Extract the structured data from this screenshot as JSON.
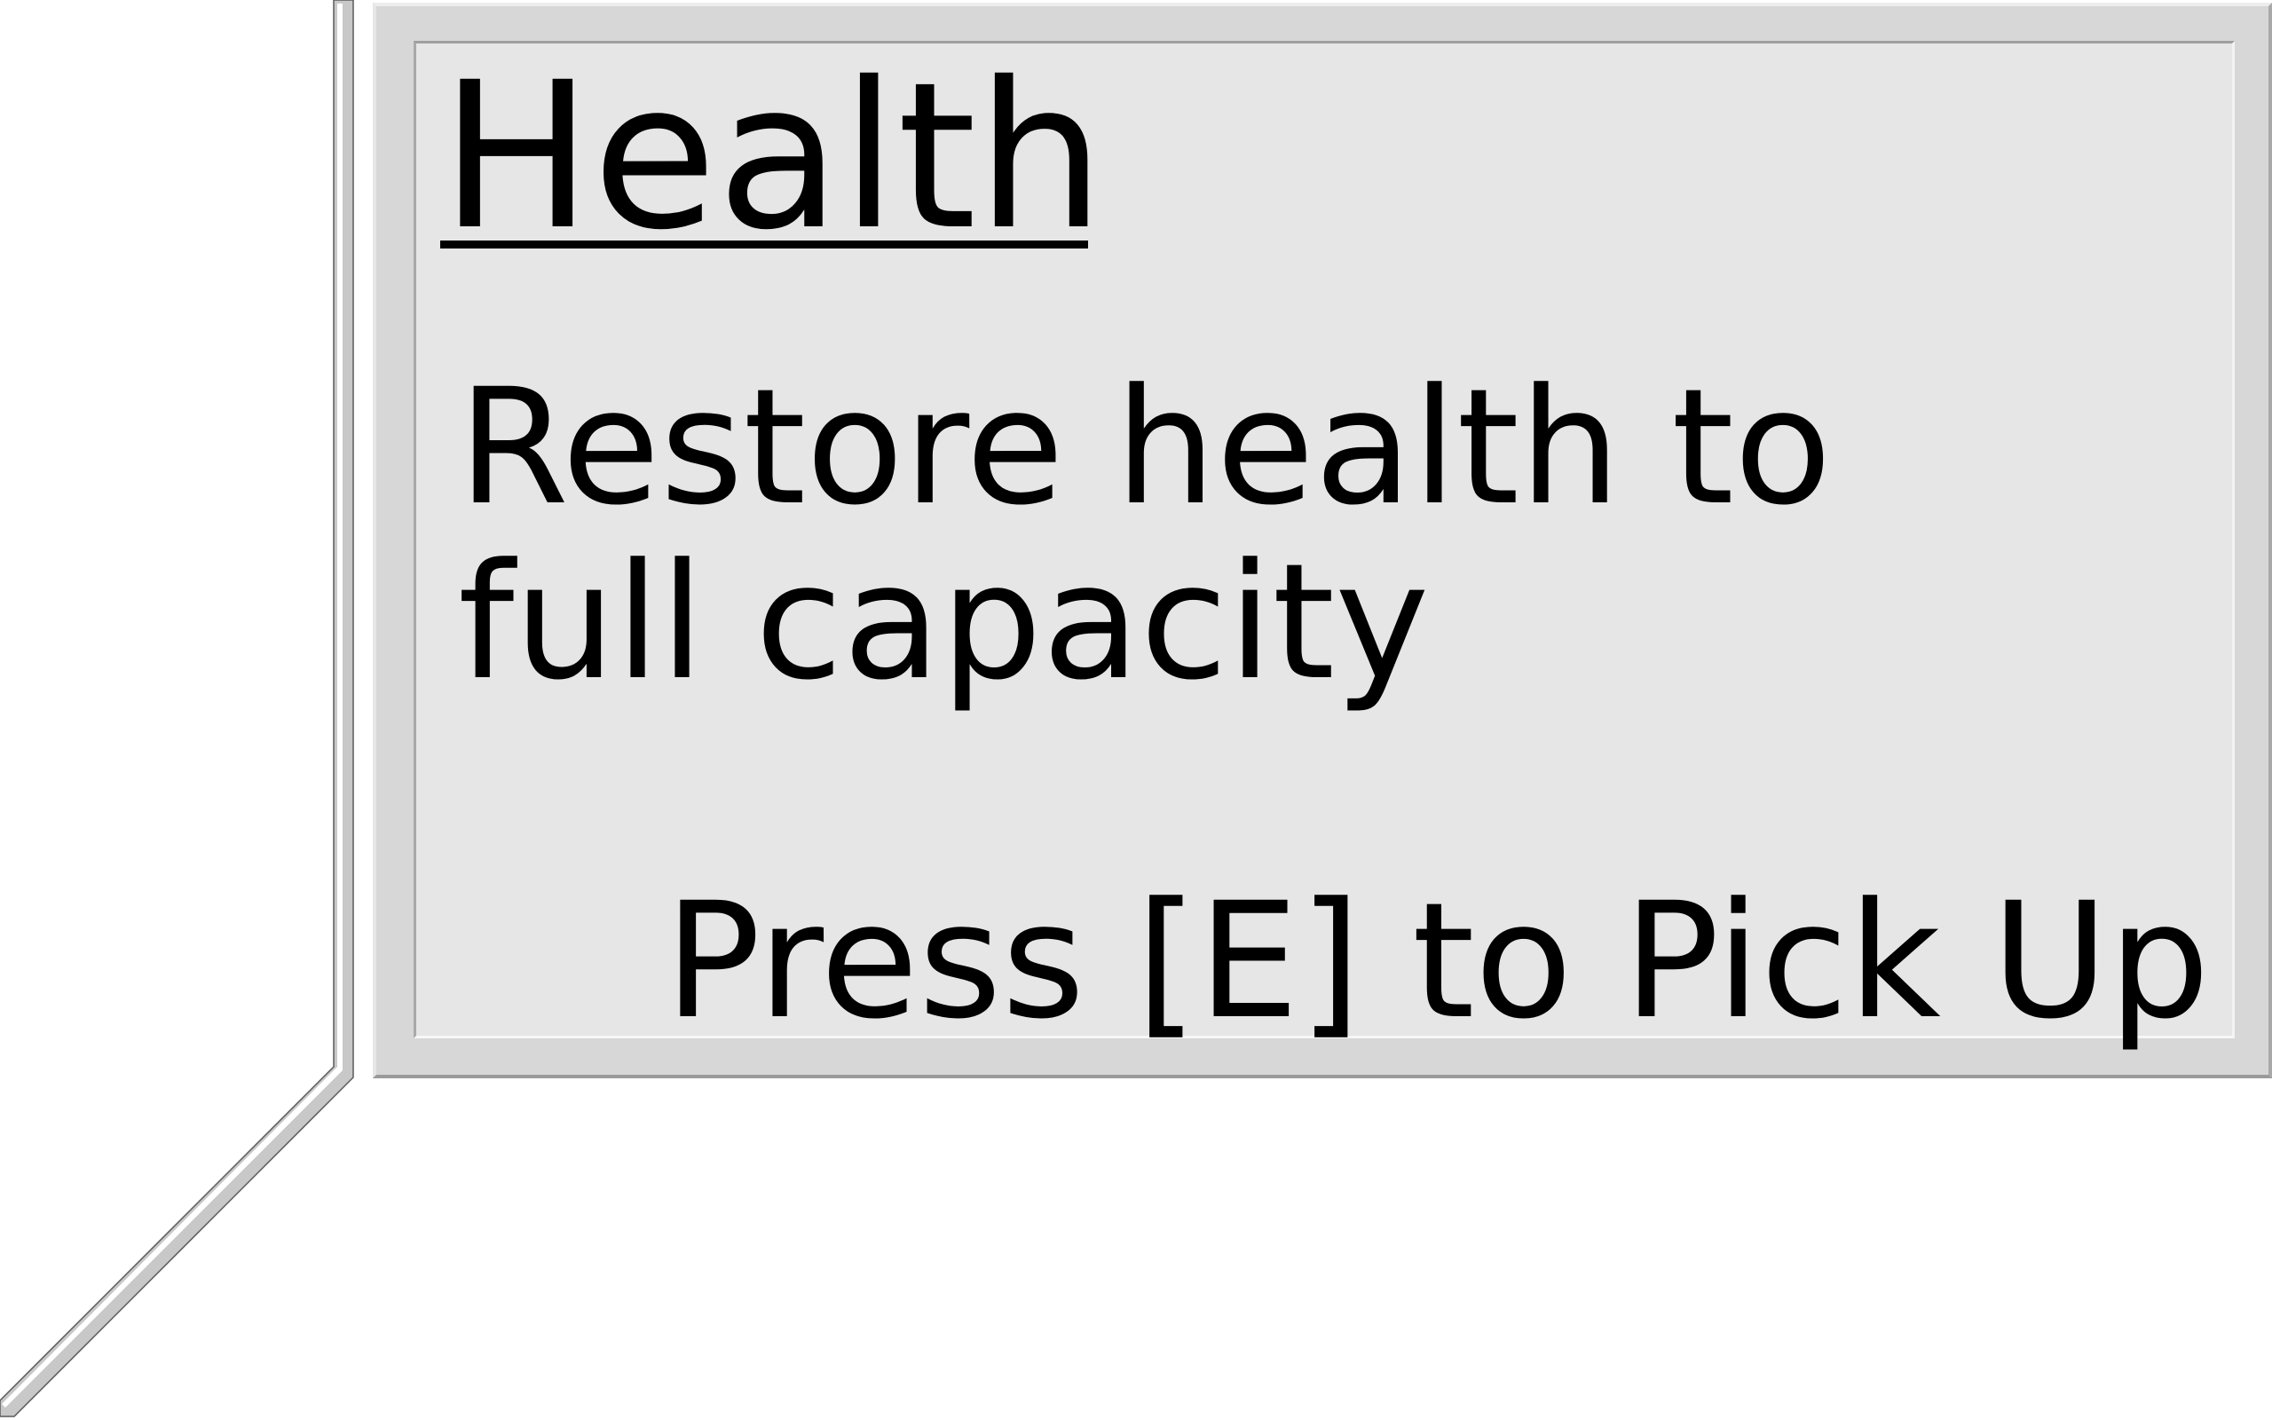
{
  "pickup_tooltip": {
    "title": "Health",
    "description": "Restore health to full capacity",
    "prompt": "Press [E] to Pick Up"
  },
  "colors": {
    "background": "#ffffff",
    "panel_frame": "#d7d7d7",
    "panel_face": "#e6e6e6",
    "text": "#000000"
  }
}
